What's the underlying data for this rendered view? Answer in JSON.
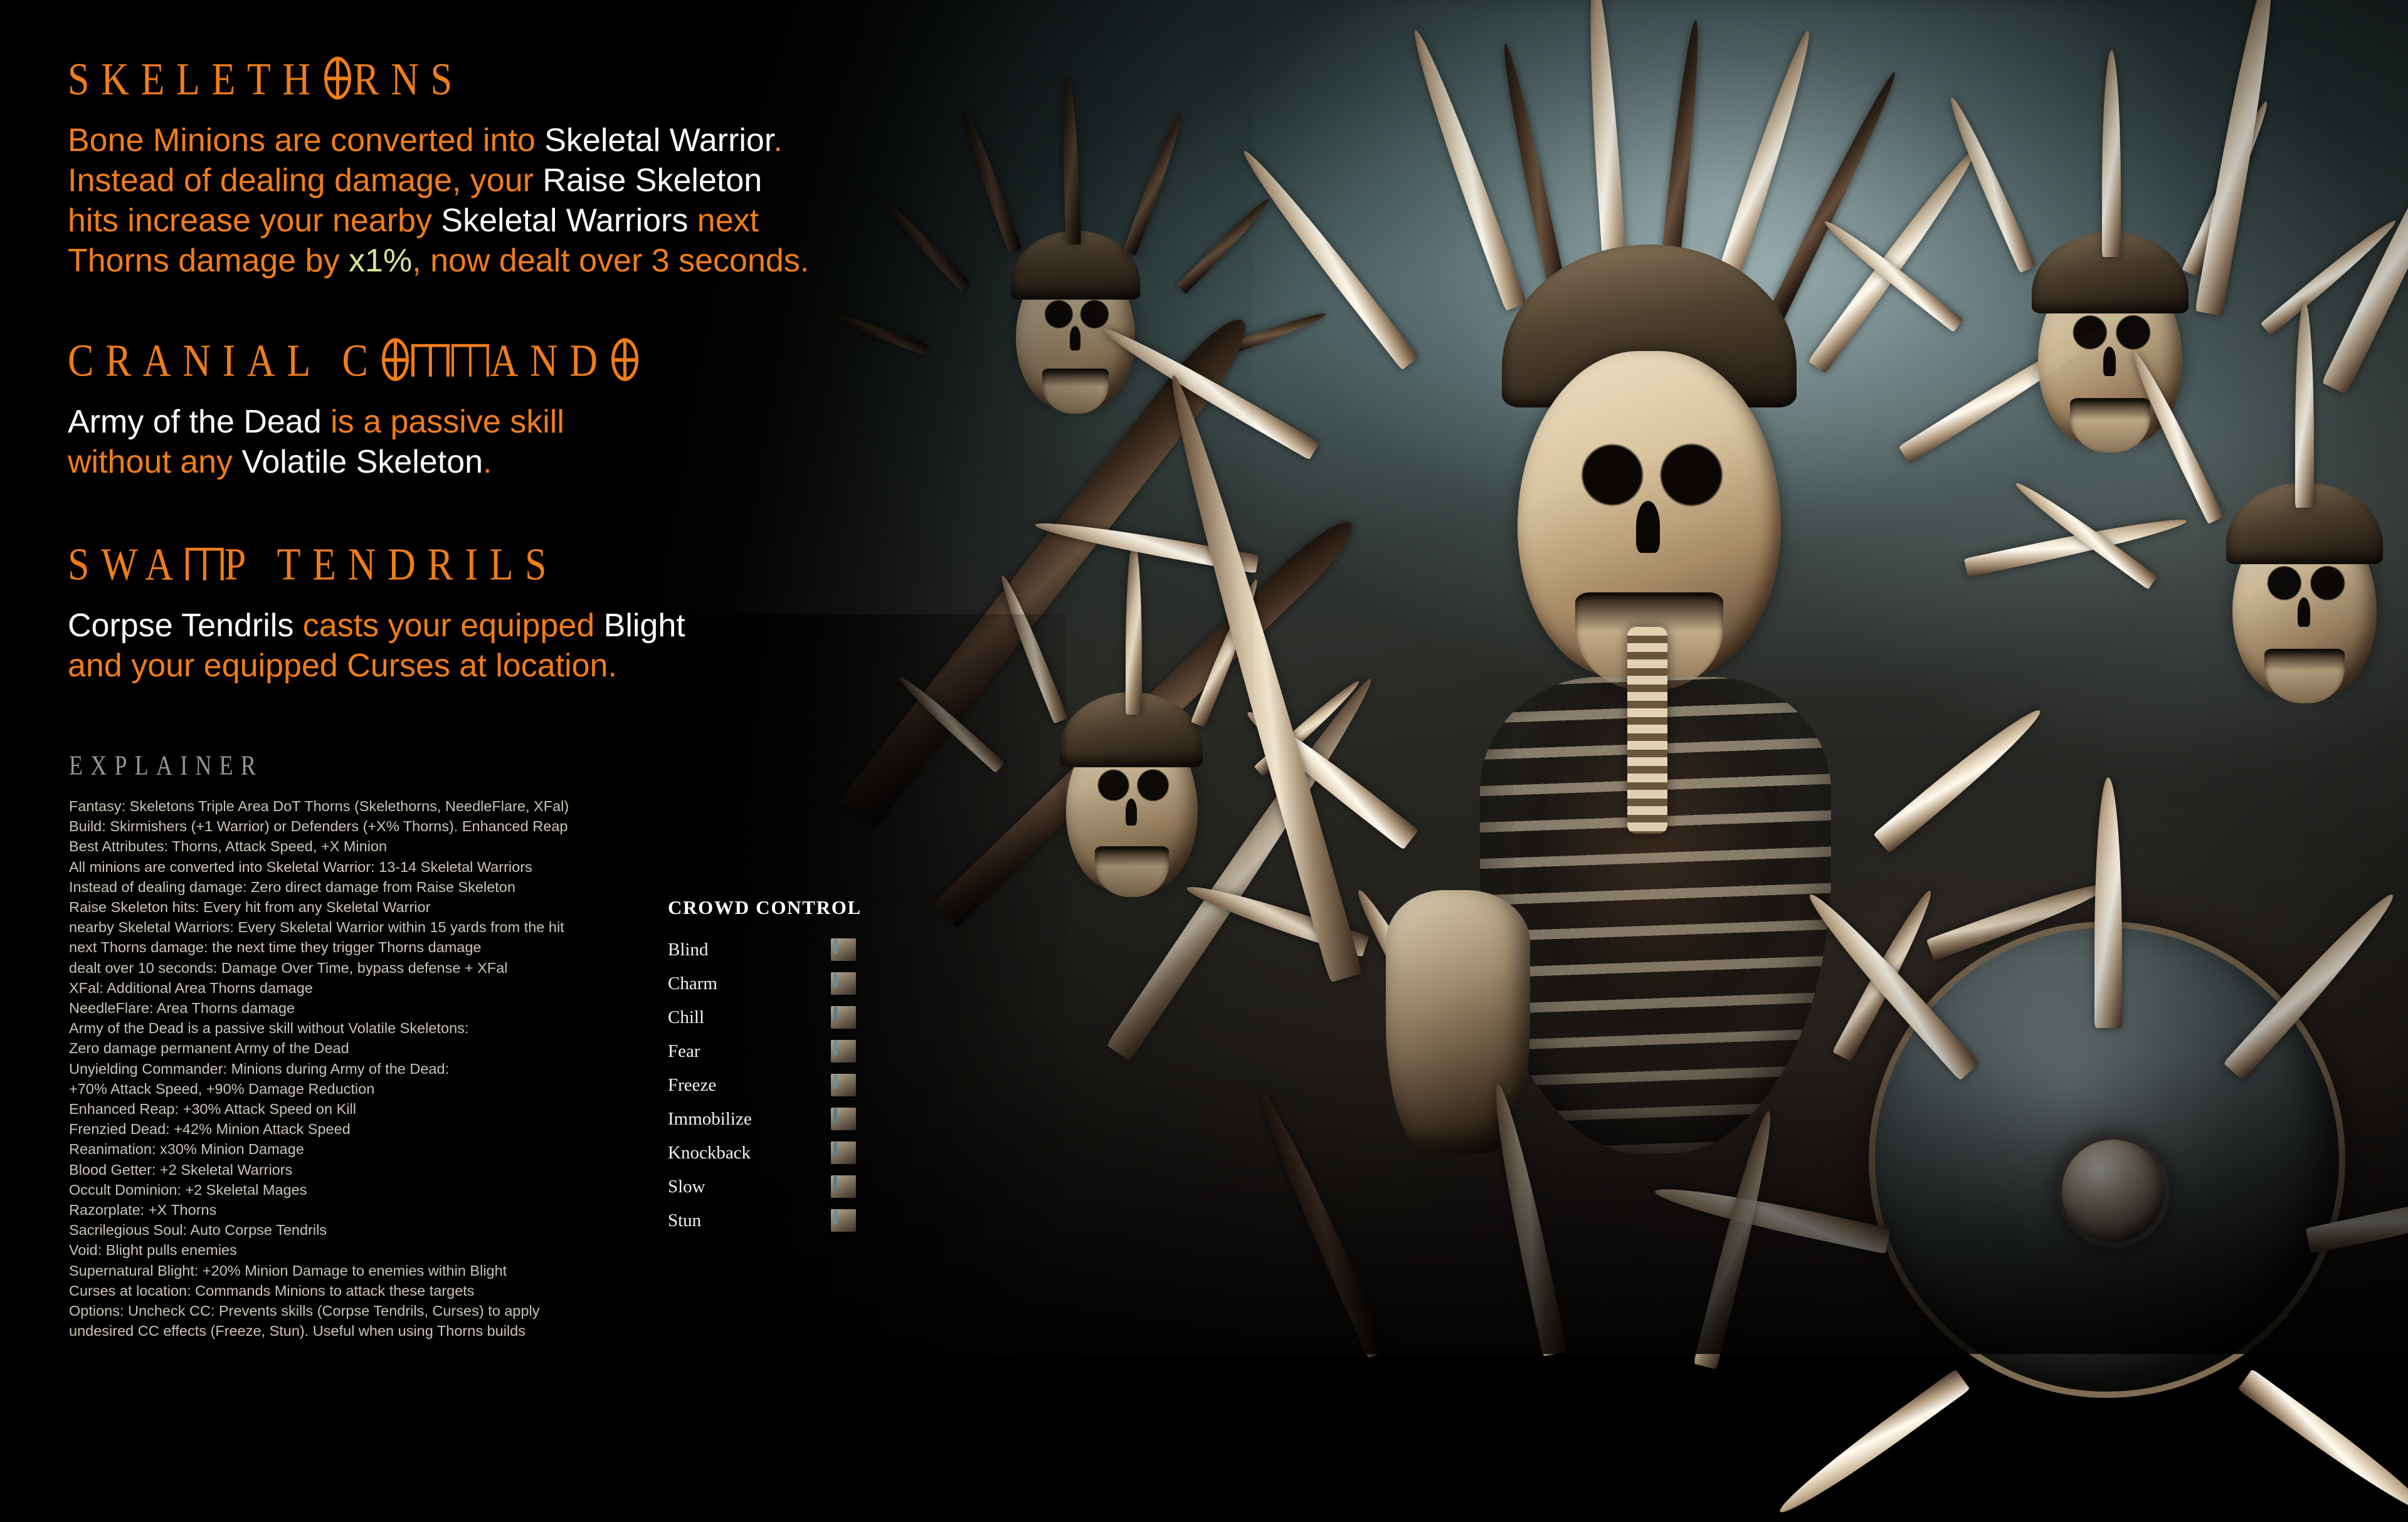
{
  "colors": {
    "accent_orange": "#f07d18",
    "white": "#ffffff",
    "green_value": "#d7e496",
    "explainer_grey": "#c9c4b4",
    "explainer_heading_grey": "#9a9894"
  },
  "sections": [
    {
      "heading": "SKELETHORNS",
      "heading_special_char": "O",
      "lines": [
        [
          {
            "t": "Bone Minions are converted into ",
            "c": "orange"
          },
          {
            "t": "Skeletal Warrior",
            "c": "white"
          },
          {
            "t": ".",
            "c": "orange"
          }
        ],
        [
          {
            "t": "Instead of dealing damage, your ",
            "c": "orange"
          },
          {
            "t": "Raise Skeleton",
            "c": "white"
          }
        ],
        [
          {
            "t": "hits increase your nearby ",
            "c": "orange"
          },
          {
            "t": "Skeletal Warriors",
            "c": "white"
          },
          {
            "t": " next",
            "c": "orange"
          }
        ],
        [
          {
            "t": "Thorns damage by ",
            "c": "orange"
          },
          {
            "t": "x1%",
            "c": "green"
          },
          {
            "t": ", now dealt over 3 seconds.",
            "c": "orange"
          }
        ]
      ]
    },
    {
      "heading": "CRANIAL COMMANDO",
      "lines": [
        [
          {
            "t": "Army of the Dead",
            "c": "white"
          },
          {
            "t": " is a passive skill",
            "c": "orange"
          }
        ],
        [
          {
            "t": "without any ",
            "c": "orange"
          },
          {
            "t": "Volatile Skeleton",
            "c": "white"
          },
          {
            "t": ".",
            "c": "orange"
          }
        ]
      ]
    },
    {
      "heading": "SWAMP TENDRILS",
      "lines": [
        [
          {
            "t": "Corpse Tendrils",
            "c": "white"
          },
          {
            "t": " casts your equipped ",
            "c": "orange"
          },
          {
            "t": "Blight",
            "c": "white"
          }
        ],
        [
          {
            "t": "and your equipped Curses at location.",
            "c": "orange"
          }
        ]
      ]
    }
  ],
  "explainer": {
    "heading": "EXPLAINER",
    "lines": [
      "Fantasy: Skeletons Triple Area DoT Thorns (Skelethorns, NeedleFlare, XFal)",
      "Build: Skirmishers (+1 Warrior) or Defenders (+X% Thorns). Enhanced Reap",
      "Best Attributes: Thorns, Attack Speed, +X Minion",
      "All minions are converted into Skeletal Warrior: 13-14 Skeletal Warriors",
      "Instead of dealing damage: Zero direct damage from Raise Skeleton",
      "Raise Skeleton hits: Every hit from any Skeletal Warrior",
      "nearby Skeletal Warriors: Every Skeletal Warrior within 15 yards from the hit",
      "next Thorns damage: the next time they trigger Thorns damage",
      "dealt over 10 seconds: Damage Over Time, bypass defense + XFal",
      "XFal: Additional Area Thorns damage",
      "NeedleFlare: Area Thorns damage",
      "Army of the Dead is a passive skill without Volatile Skeletons:",
      "Zero damage permanent Army of the Dead",
      "Unyielding Commander: Minions during Army of the Dead:",
      "+70% Attack Speed, +90% Damage Reduction",
      "Enhanced Reap: +30% Attack Speed on Kill",
      "Frenzied Dead: +42% Minion Attack Speed",
      "Reanimation: x30% Minion Damage",
      "Blood Getter: +2 Skeletal Warriors",
      "Occult Dominion: +2 Skeletal Mages",
      "Razorplate: +X Thorns",
      "Sacrilegious Soul: Auto Corpse Tendrils",
      "Void: Blight pulls enemies",
      "Supernatural Blight: +20% Minion Damage to enemies within Blight",
      "Curses at location: Commands Minions to attack these targets",
      "Options: Uncheck CC: Prevents skills (Corpse Tendrils, Curses) to apply",
      "undesired CC effects (Freeze, Stun). Useful when using Thorns builds"
    ]
  },
  "crowd_control": {
    "heading": "CROWD CONTROL",
    "items": [
      {
        "label": "Blind",
        "checked": false
      },
      {
        "label": "Charm",
        "checked": false
      },
      {
        "label": "Chill",
        "checked": true
      },
      {
        "label": "Fear",
        "checked": false
      },
      {
        "label": "Freeze",
        "checked": false
      },
      {
        "label": "Immobilize",
        "checked": true
      },
      {
        "label": "Knockback",
        "checked": true
      },
      {
        "label": "Slow",
        "checked": true
      },
      {
        "label": "Stun",
        "checked": false
      }
    ]
  },
  "artwork": {
    "description": "Spiked skeletal warriors with bone spines and spiked shield against a pale teal sky"
  }
}
